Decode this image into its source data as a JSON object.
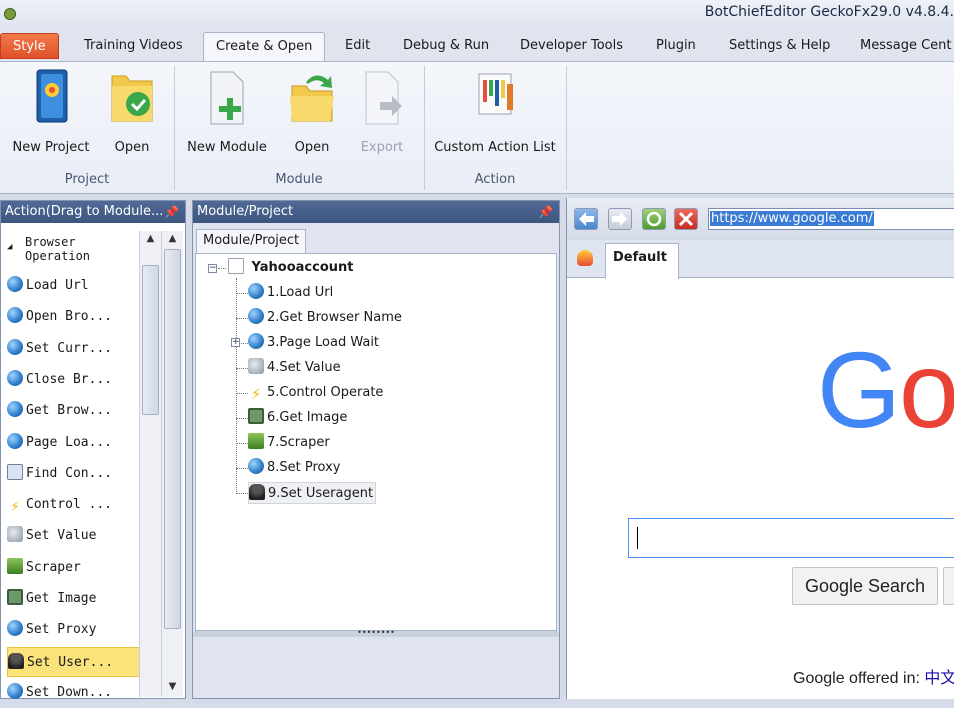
{
  "window": {
    "title": "BotChiefEditor GeckoFx29.0 v4.8.4."
  },
  "ribbon_tabs": [
    "Style",
    "Training Videos",
    "Create & Open",
    "Edit",
    "Debug & Run",
    "Developer Tools",
    "Plugin",
    "Settings & Help",
    "Message Cent"
  ],
  "ribbon": {
    "groups": {
      "project": "Project",
      "module": "Module",
      "action": "Action"
    },
    "buttons": {
      "new_project": "New Project",
      "open_project": "Open",
      "new_module": "New Module",
      "open_module": "Open",
      "export": "Export",
      "custom_action_list": "Custom Action List"
    }
  },
  "action_panel": {
    "title": "Action(Drag to Module...",
    "category": "Browser Operation",
    "items": [
      {
        "label": "Load Url",
        "icon": "globe-icon"
      },
      {
        "label": "Open Bro...",
        "icon": "globe-icon"
      },
      {
        "label": "Set Curr...",
        "icon": "globe-icon"
      },
      {
        "label": "Close Br...",
        "icon": "globe-icon"
      },
      {
        "label": "Get Brow...",
        "icon": "globe-icon"
      },
      {
        "label": "Page Loa...",
        "icon": "globe-icon"
      },
      {
        "label": "Find Con...",
        "icon": "find-icon"
      },
      {
        "label": "Control ...",
        "icon": "lightning-icon"
      },
      {
        "label": "Set Value",
        "icon": "gear-icon"
      },
      {
        "label": "Scraper",
        "icon": "scraper-icon"
      },
      {
        "label": "Get Image",
        "icon": "image-icon"
      },
      {
        "label": "Set Proxy",
        "icon": "globe-icon"
      },
      {
        "label": "Set User...",
        "icon": "agent-icon",
        "selected": true
      },
      {
        "label": "Set Down...",
        "icon": "globe-icon"
      }
    ]
  },
  "module_panel": {
    "title": "Module/Project",
    "tab": "Module/Project",
    "root": "Yahooaccount",
    "items": [
      {
        "label": "1.Load Url",
        "icon": "globe-icon"
      },
      {
        "label": "2.Get Browser Name",
        "icon": "globe-icon"
      },
      {
        "label": "3.Page Load Wait",
        "icon": "globe-icon",
        "expandable": true
      },
      {
        "label": "4.Set Value",
        "icon": "gear-icon"
      },
      {
        "label": "5.Control Operate",
        "icon": "lightning-icon"
      },
      {
        "label": "6.Get Image",
        "icon": "image-icon"
      },
      {
        "label": "7.Scraper",
        "icon": "scraper-icon"
      },
      {
        "label": "8.Set Proxy",
        "icon": "globe-icon"
      },
      {
        "label": "9.Set Useragent",
        "icon": "agent-icon",
        "selected": true
      }
    ]
  },
  "browser": {
    "url": "https://www.google.com/",
    "tab": "Default",
    "search_button": "Google Search",
    "offered_in": "Google offered in:",
    "offered_lang": "中文"
  },
  "colors": {
    "style_tab": "#e0502a",
    "panel_header": "#3d5680",
    "selection": "#fbe27a",
    "google_blue": "#4285f4",
    "google_red": "#ea4335"
  }
}
